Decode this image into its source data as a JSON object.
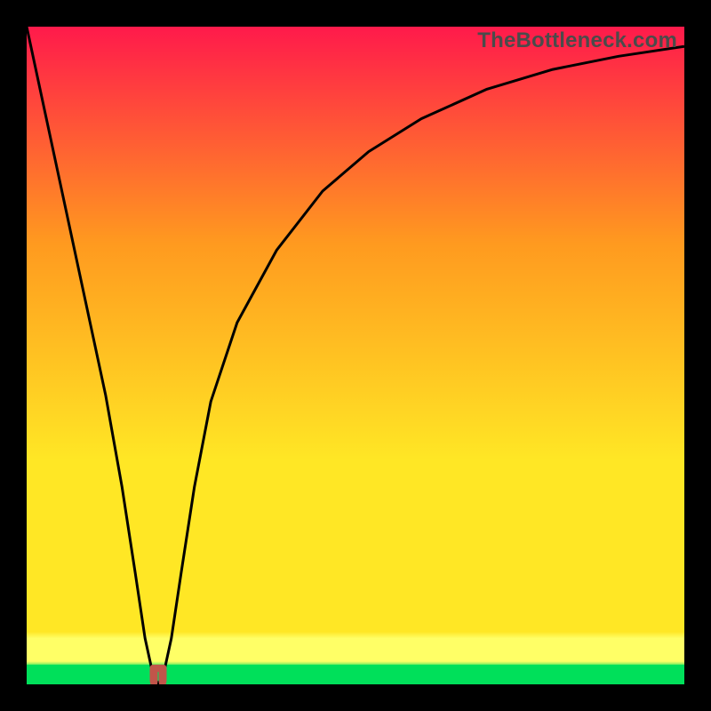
{
  "watermark": "TheBottleneck.com",
  "chart_data": {
    "type": "line",
    "title": "",
    "xlabel": "",
    "ylabel": "",
    "xlim": [
      0,
      100
    ],
    "ylim": [
      0,
      100
    ],
    "legend": false,
    "grid": false,
    "background_gradient": [
      "#ff1a4b",
      "#ff9a1f",
      "#ffe725",
      "#ffff66",
      "#00e05a"
    ],
    "green_band_fraction": 0.03,
    "series": [
      {
        "name": "bottleneck-curve",
        "x": [
          0,
          3,
          6,
          9,
          12,
          14.5,
          16.5,
          18,
          19.2,
          20,
          20.8,
          22,
          23.5,
          25.5,
          28,
          32,
          38,
          45,
          52,
          60,
          70,
          80,
          90,
          100
        ],
        "values": [
          100,
          86,
          72,
          58,
          44,
          30,
          17,
          7,
          1.5,
          0,
          1.5,
          7,
          17,
          30,
          43,
          55,
          66,
          75,
          81,
          86,
          90.5,
          93.5,
          95.5,
          97
        ],
        "color": "#000000"
      }
    ],
    "markers": [
      {
        "name": "optimal-point",
        "shape": "dip",
        "x": 20,
        "y": 0.5,
        "color": "#c1554a"
      }
    ]
  }
}
